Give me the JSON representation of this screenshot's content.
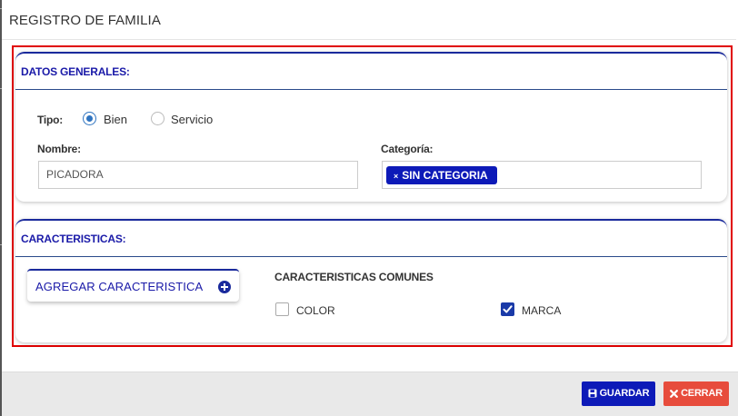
{
  "modal": {
    "title": "REGISTRO DE FAMILIA"
  },
  "general": {
    "heading": "DATOS GENERALES:",
    "tipo_label": "Tipo:",
    "tipo_options": [
      {
        "label": "Bien",
        "selected": true
      },
      {
        "label": "Servicio",
        "selected": false
      }
    ],
    "nombre_label": "Nombre:",
    "nombre_value": "PICADORA",
    "categoria_label": "Categoría:",
    "categoria_tag": "SIN CATEGORIA",
    "categoria_tag_remove": "×"
  },
  "features": {
    "heading": "CARACTERISTICAS:",
    "add_button": "AGREGAR CARACTERISTICA",
    "common_heading": "CARACTERISTICAS COMUNES",
    "common_items": [
      {
        "label": "COLOR",
        "checked": false
      },
      {
        "label": "MARCA",
        "checked": true
      }
    ]
  },
  "footer": {
    "save_label": "GUARDAR",
    "close_label": "CERRAR"
  },
  "colors": {
    "accent": "#0d1ab8",
    "danger": "#e74c3c",
    "highlight_frame": "#e00000"
  }
}
